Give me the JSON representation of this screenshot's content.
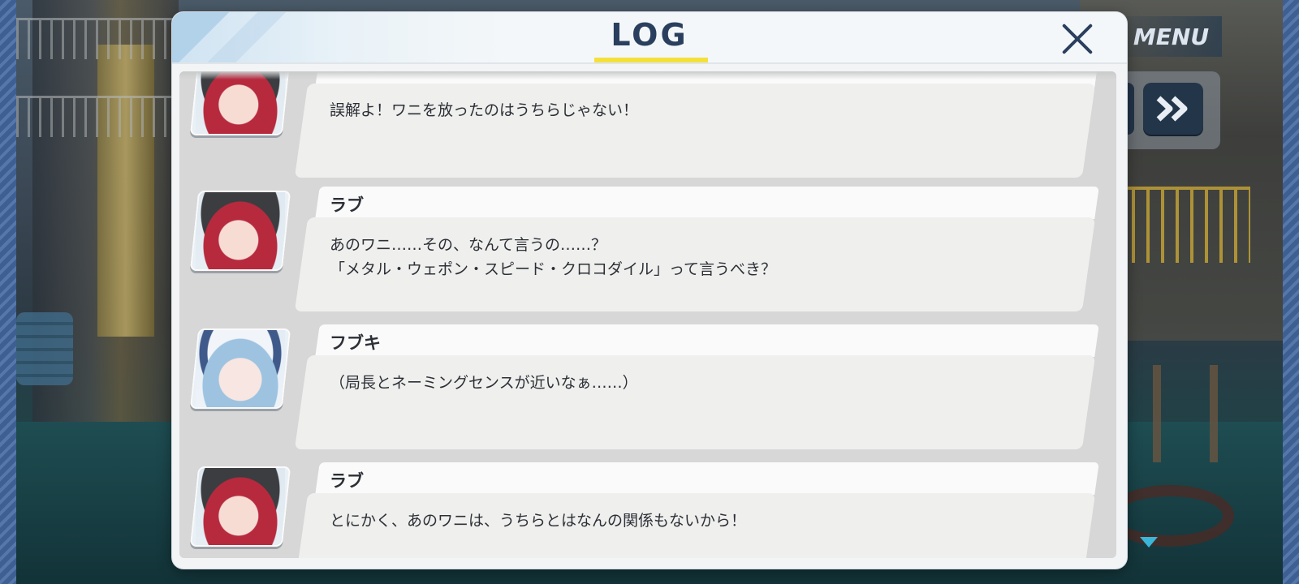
{
  "hud": {
    "menu_label": "MENU",
    "fast_forward_icon": "double-chevron-right-icon"
  },
  "dialog": {
    "title": "LOG",
    "close_icon": "close-icon",
    "accent_color": "#f4e03a"
  },
  "entries": [
    {
      "speaker": "",
      "portrait": "rabu",
      "lines": [
        "誤解よ！ワニを放ったのはうちらじゃない！"
      ]
    },
    {
      "speaker": "ラブ",
      "portrait": "rabu",
      "lines": [
        "あのワニ……その、なんて言うの……？",
        "「メタル・ウェポン・スピード・クロコダイル」って言うべき？"
      ]
    },
    {
      "speaker": "フブキ",
      "portrait": "fubuki",
      "lines": [
        "（局長とネーミングセンスが近いなぁ……）"
      ]
    },
    {
      "speaker": "ラブ",
      "portrait": "rabu",
      "lines": [
        "とにかく、あのワニは、うちらとはなんの関係もないから！"
      ]
    }
  ]
}
